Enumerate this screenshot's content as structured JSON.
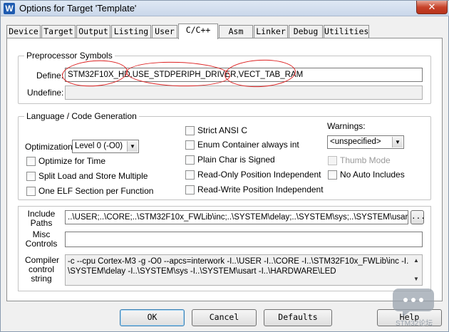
{
  "window": {
    "title": "Options for Target 'Template'",
    "app_icon_glyph": "W",
    "close_glyph": "✕"
  },
  "tabs": [
    {
      "label": "Device"
    },
    {
      "label": "Target"
    },
    {
      "label": "Output"
    },
    {
      "label": "Listing"
    },
    {
      "label": "User"
    },
    {
      "label": "C/C++",
      "active": true
    },
    {
      "label": "Asm"
    },
    {
      "label": "Linker"
    },
    {
      "label": "Debug"
    },
    {
      "label": "Utilities"
    }
  ],
  "preprocessor": {
    "group_label": "Preprocessor Symbols",
    "define_label": "Define:",
    "define_value": "STM32F10X_HD,USE_STDPERIPH_DRIVER,VECT_TAB_RAM",
    "undefine_label": "Undefine:",
    "undefine_value": ""
  },
  "language": {
    "group_label": "Language / Code Generation",
    "optimization_label": "Optimization:",
    "optimization_value": "Level 0 (-O0)",
    "left_options": [
      {
        "label": "Optimize for Time",
        "checked": false
      },
      {
        "label": "Split Load and Store Multiple",
        "checked": false
      },
      {
        "label": "One ELF Section per Function",
        "checked": false
      }
    ],
    "middle_options": [
      {
        "label": "Strict ANSI C",
        "checked": false
      },
      {
        "label": "Enum Container always int",
        "checked": false
      },
      {
        "label": "Plain Char is Signed",
        "checked": false
      },
      {
        "label": "Read-Only Position Independent",
        "checked": false
      },
      {
        "label": "Read-Write Position Independent",
        "checked": false
      }
    ],
    "warnings_label": "Warnings:",
    "warnings_value": "<unspecified>",
    "right_options": [
      {
        "label": "Thumb Mode",
        "checked": false,
        "disabled": true
      },
      {
        "label": "No Auto Includes",
        "checked": false,
        "disabled": false
      }
    ]
  },
  "paths": {
    "include_label": "Include Paths",
    "include_value": "..\\USER;..\\CORE;..\\STM32F10x_FWLib\\inc;..\\SYSTEM\\delay;..\\SYSTEM\\sys;..\\SYSTEM\\usart;..\\",
    "browse_label": "...",
    "misc_label": "Misc Controls",
    "misc_value": "",
    "compiler_label": "Compiler control string",
    "compiler_value_line1": "-c --cpu Cortex-M3 -g -O0 --apcs=interwork -I..\\USER -I..\\CORE -I..\\STM32F10x_FWLib\\inc -I..",
    "compiler_value_line2": "\\SYSTEM\\delay -I..\\SYSTEM\\sys -I..\\SYSTEM\\usart -I..\\HARDWARE\\LED"
  },
  "buttons": {
    "ok": "OK",
    "cancel": "Cancel",
    "defaults": "Defaults",
    "help": "Help"
  },
  "watermark": {
    "text": "STM32论坛"
  },
  "colors": {
    "annotation_red": "#d22222",
    "active_tab": "#ffffff",
    "panel": "#f0f0f0"
  }
}
